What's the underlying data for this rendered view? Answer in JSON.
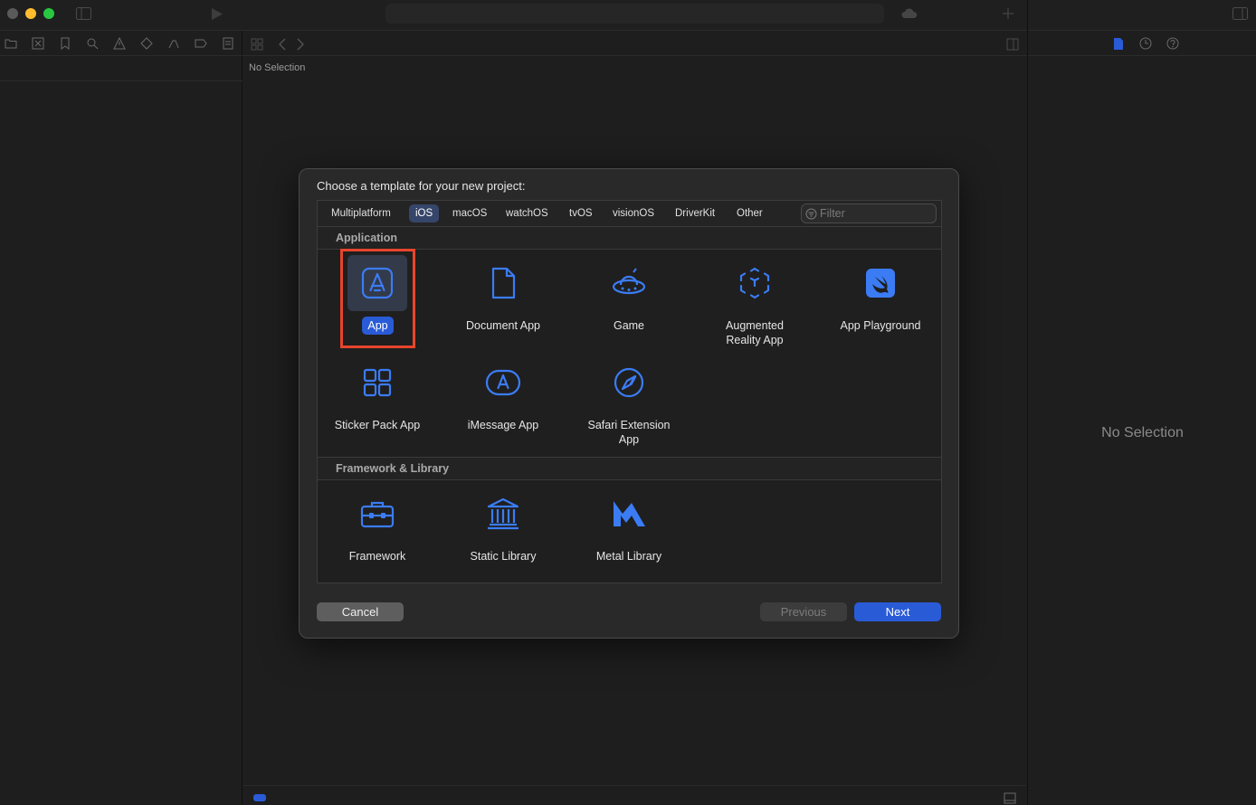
{
  "colors": {
    "accent": "#2a5bd7",
    "icon_blue": "#3b7cf5",
    "highlight": "#e8452c",
    "traffic_close": "#5a5a5a",
    "traffic_min": "#febc2e",
    "traffic_zoom": "#28c840"
  },
  "editor": {
    "no_selection": "No Selection"
  },
  "inspector": {
    "no_selection": "No Selection"
  },
  "dialog": {
    "title": "Choose a template for your new project:",
    "platform_tabs": [
      "Multiplatform",
      "iOS",
      "macOS",
      "watchOS",
      "tvOS",
      "visionOS",
      "DriverKit",
      "Other"
    ],
    "selected_platform": "iOS",
    "filter": {
      "placeholder": "Filter",
      "value": ""
    },
    "sections": [
      {
        "header": "Application",
        "templates": [
          {
            "label": "App",
            "icon": "app-store-icon",
            "selected": true
          },
          {
            "label": "Document App",
            "icon": "document-icon"
          },
          {
            "label": "Game",
            "icon": "game-ufo-icon"
          },
          {
            "label": "Augmented\nReality App",
            "icon": "ar-cube-icon"
          },
          {
            "label": "App Playground",
            "icon": "swift-icon"
          },
          {
            "label": "Sticker Pack App",
            "icon": "sticker-grid-icon"
          },
          {
            "label": "iMessage App",
            "icon": "imessage-app-icon"
          },
          {
            "label": "Safari Extension\nApp",
            "icon": "safari-compass-icon"
          }
        ]
      },
      {
        "header": "Framework & Library",
        "templates": [
          {
            "label": "Framework",
            "icon": "toolbox-icon"
          },
          {
            "label": "Static Library",
            "icon": "library-columns-icon"
          },
          {
            "label": "Metal Library",
            "icon": "metal-icon"
          }
        ]
      }
    ],
    "buttons": {
      "cancel": "Cancel",
      "previous": "Previous",
      "next": "Next"
    }
  }
}
